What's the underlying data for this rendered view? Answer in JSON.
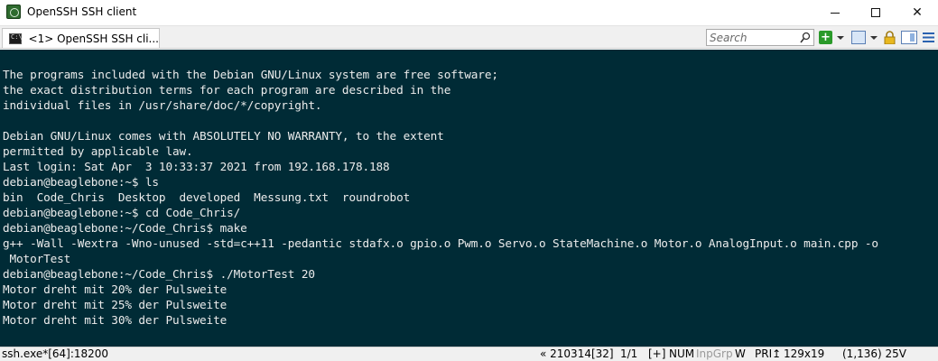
{
  "window": {
    "title": "OpenSSH SSH client",
    "minimize_label": "",
    "close_label": "✕"
  },
  "tabbar": {
    "tab_label": "<1> OpenSSH SSH cli...",
    "search_placeholder": "Search",
    "add_label": "+"
  },
  "terminal": {
    "lines": [
      "",
      "The programs included with the Debian GNU/Linux system are free software;",
      "the exact distribution terms for each program are described in the",
      "individual files in /usr/share/doc/*/copyright.",
      "",
      "Debian GNU/Linux comes with ABSOLUTELY NO WARRANTY, to the extent",
      "permitted by applicable law.",
      "Last login: Sat Apr  3 10:33:37 2021 from 192.168.178.188",
      "debian@beaglebone:~$ ls",
      "bin  Code_Chris  Desktop  developed  Messung.txt  roundrobot",
      "debian@beaglebone:~$ cd Code_Chris/",
      "debian@beaglebone:~/Code_Chris$ make",
      "g++ -Wall -Wextra -Wno-unused -std=c++11 -pedantic stdafx.o gpio.o Pwm.o Servo.o StateMachine.o Motor.o AnalogInput.o main.cpp -o",
      " MotorTest",
      "debian@beaglebone:~/Code_Chris$ ./MotorTest 20",
      "Motor dreht mit 20% der Pulsweite",
      "Motor dreht mit 25% der Pulsweite",
      "Motor dreht mit 30% der Pulsweite"
    ]
  },
  "statusbar": {
    "process": "ssh.exe*[64]:18200",
    "position": "« 210314[32]",
    "pages": "1/1",
    "plus": "[+]",
    "num": "NUM",
    "inpgrp": "InpGrp",
    "w": "W",
    "pri": "PRI↥",
    "size": "129x19",
    "cursor": "(1,136) 25V"
  },
  "colors": {
    "terminal_bg": "#002b36",
    "terminal_fg": "#ececec"
  }
}
